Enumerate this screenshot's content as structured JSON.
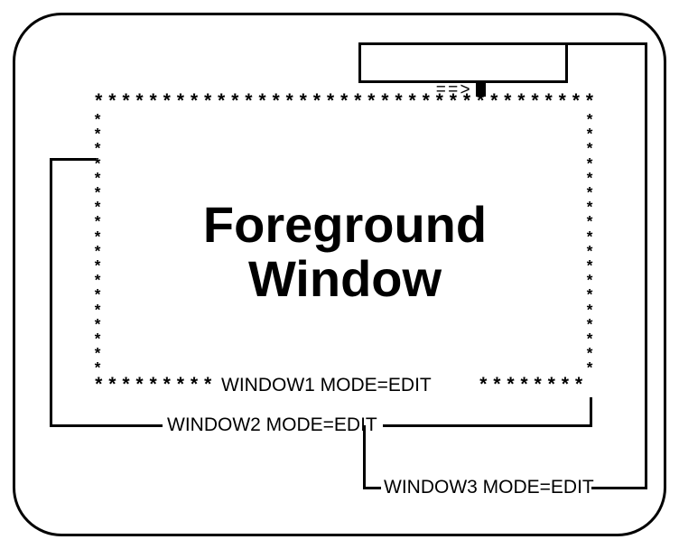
{
  "prompt_text": "==>",
  "foreground_title_line1": "Foreground",
  "foreground_title_line2": "Window",
  "window1_status": "WINDOW1 MODE=EDIT",
  "window2_status": "WINDOW2 MODE=EDIT",
  "window3_status": "WINDOW3 MODE=EDIT",
  "star_top": "*************************************",
  "star_bottom_left": "*********",
  "star_bottom_right": "********",
  "star_col": "*\n*\n*\n*\n*\n*\n*\n*\n*\n*\n*\n*\n*\n*\n*\n*\n*\n*"
}
